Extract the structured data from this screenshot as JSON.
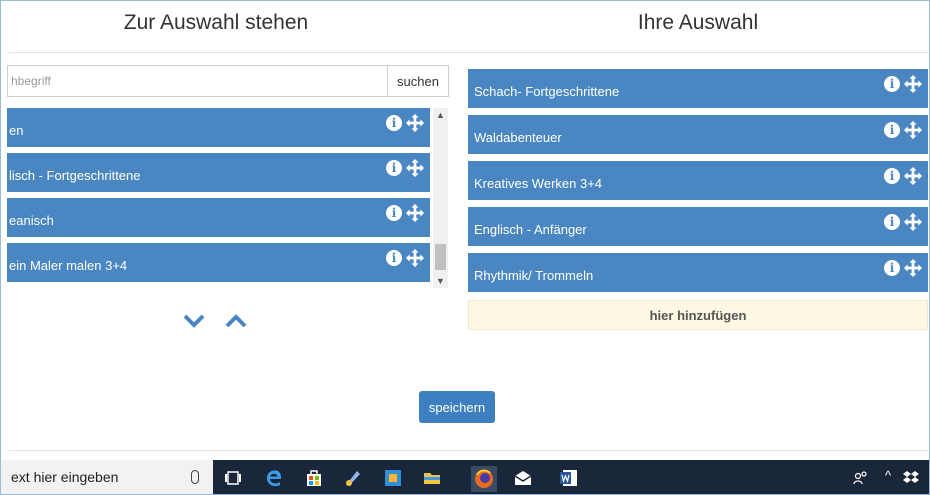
{
  "headings": {
    "available": "Zur Auswahl stehen",
    "selected": "Ihre Auswahl"
  },
  "search": {
    "placeholder": "hbegriff",
    "button_label": "suchen"
  },
  "available_items": [
    {
      "label": "en"
    },
    {
      "label": "lisch - Fortgeschrittene"
    },
    {
      "label": "eanisch"
    },
    {
      "label": " ein Maler malen 3+4"
    }
  ],
  "selected_items": [
    {
      "label": "Schach- Fortgeschrittene"
    },
    {
      "label": "Waldabenteuer"
    },
    {
      "label": "Kreatives Werken 3+4"
    },
    {
      "label": "Englisch - Anfänger"
    },
    {
      "label": "Rhythmik/ Trommeln"
    }
  ],
  "add_here_label": "hier hinzufügen",
  "save_label": "speichern",
  "taskbar": {
    "search_text": "ext hier eingeben"
  },
  "colors": {
    "item_bg": "#4a87c2",
    "add_here_bg": "#fcf8e3",
    "save_bg": "#3d7fc1",
    "taskbar_bg": "#1a2639"
  },
  "icons": {
    "info": "info-icon",
    "move": "move-arrows-icon",
    "down": "chevron-down-icon",
    "up": "chevron-up-icon"
  }
}
